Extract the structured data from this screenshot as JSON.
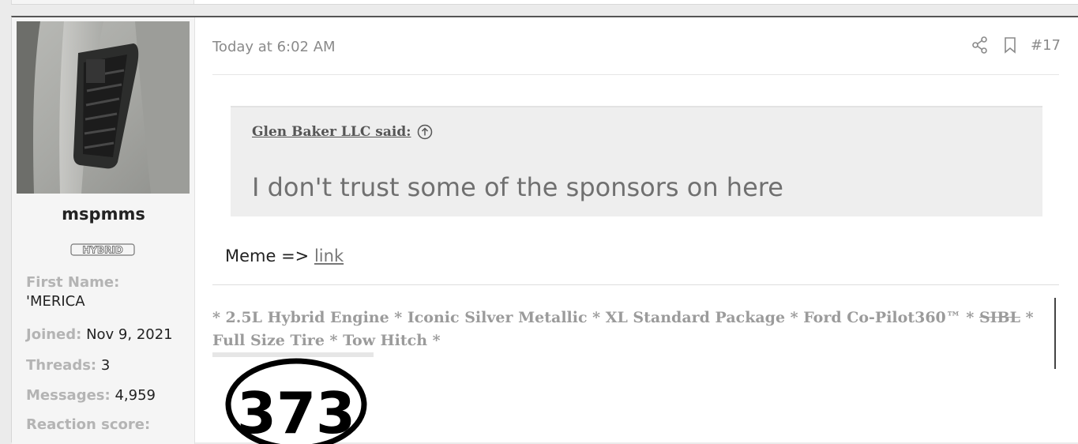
{
  "user": {
    "username": "mspmms",
    "badge_label": "HYBRID",
    "fields": [
      {
        "key": "First Name:",
        "value": "'MERICA"
      },
      {
        "key": "Joined:",
        "value": "Nov 9, 2021"
      },
      {
        "key": "Threads:",
        "value": "3"
      },
      {
        "key": "Messages:",
        "value": "4,959"
      },
      {
        "key": "Reaction score:",
        "value": ""
      }
    ]
  },
  "post": {
    "time": "Today at 6:02 AM",
    "number": "#17",
    "quote": {
      "author": "Glen Baker LLC said:",
      "text": "I don't trust some of the sponsors on here"
    },
    "reply": {
      "prefix": "Meme => ",
      "link_text": "link"
    },
    "signature": {
      "part1": "* 2.5L Hybrid Engine * Iconic Silver Metallic * XL Standard Package * Ford Co-Pilot360™ * ",
      "struck": "SIBL",
      "part2": " * Full Size Tire * Tow Hitch *",
      "logo_text": "373"
    }
  },
  "icons": {
    "share": "share-icon",
    "bookmark": "bookmark-icon",
    "quote_jump": "arrow-up-circle-icon"
  }
}
